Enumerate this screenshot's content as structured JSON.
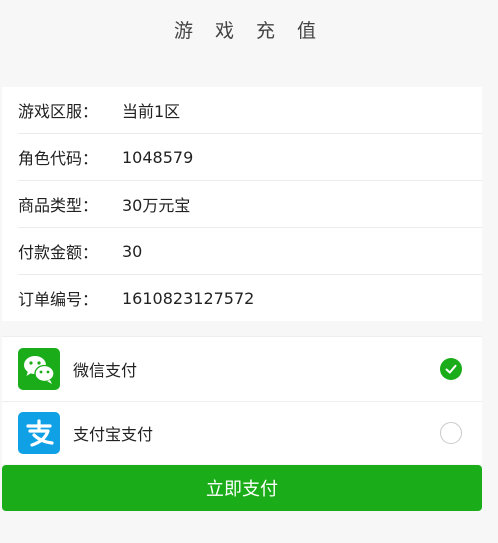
{
  "header": {
    "title": "游 戏 充 值"
  },
  "order_info": [
    {
      "label": "游戏区服：",
      "value": "当前1区"
    },
    {
      "label": "角色代码：",
      "value": "1048579"
    },
    {
      "label": "商品类型：",
      "value": "30万元宝"
    },
    {
      "label": "付款金额：",
      "value": "30"
    },
    {
      "label": "订单编号：",
      "value": "1610823127572"
    }
  ],
  "payment_methods": [
    {
      "label": "微信支付",
      "icon": "wechat-icon",
      "selected": true,
      "color": "#1aad19"
    },
    {
      "label": "支付宝支付",
      "icon": "alipay-icon",
      "selected": false,
      "color": "#0fa0e6"
    }
  ],
  "pay_button": {
    "label": "立即支付",
    "color": "#1aad19"
  }
}
